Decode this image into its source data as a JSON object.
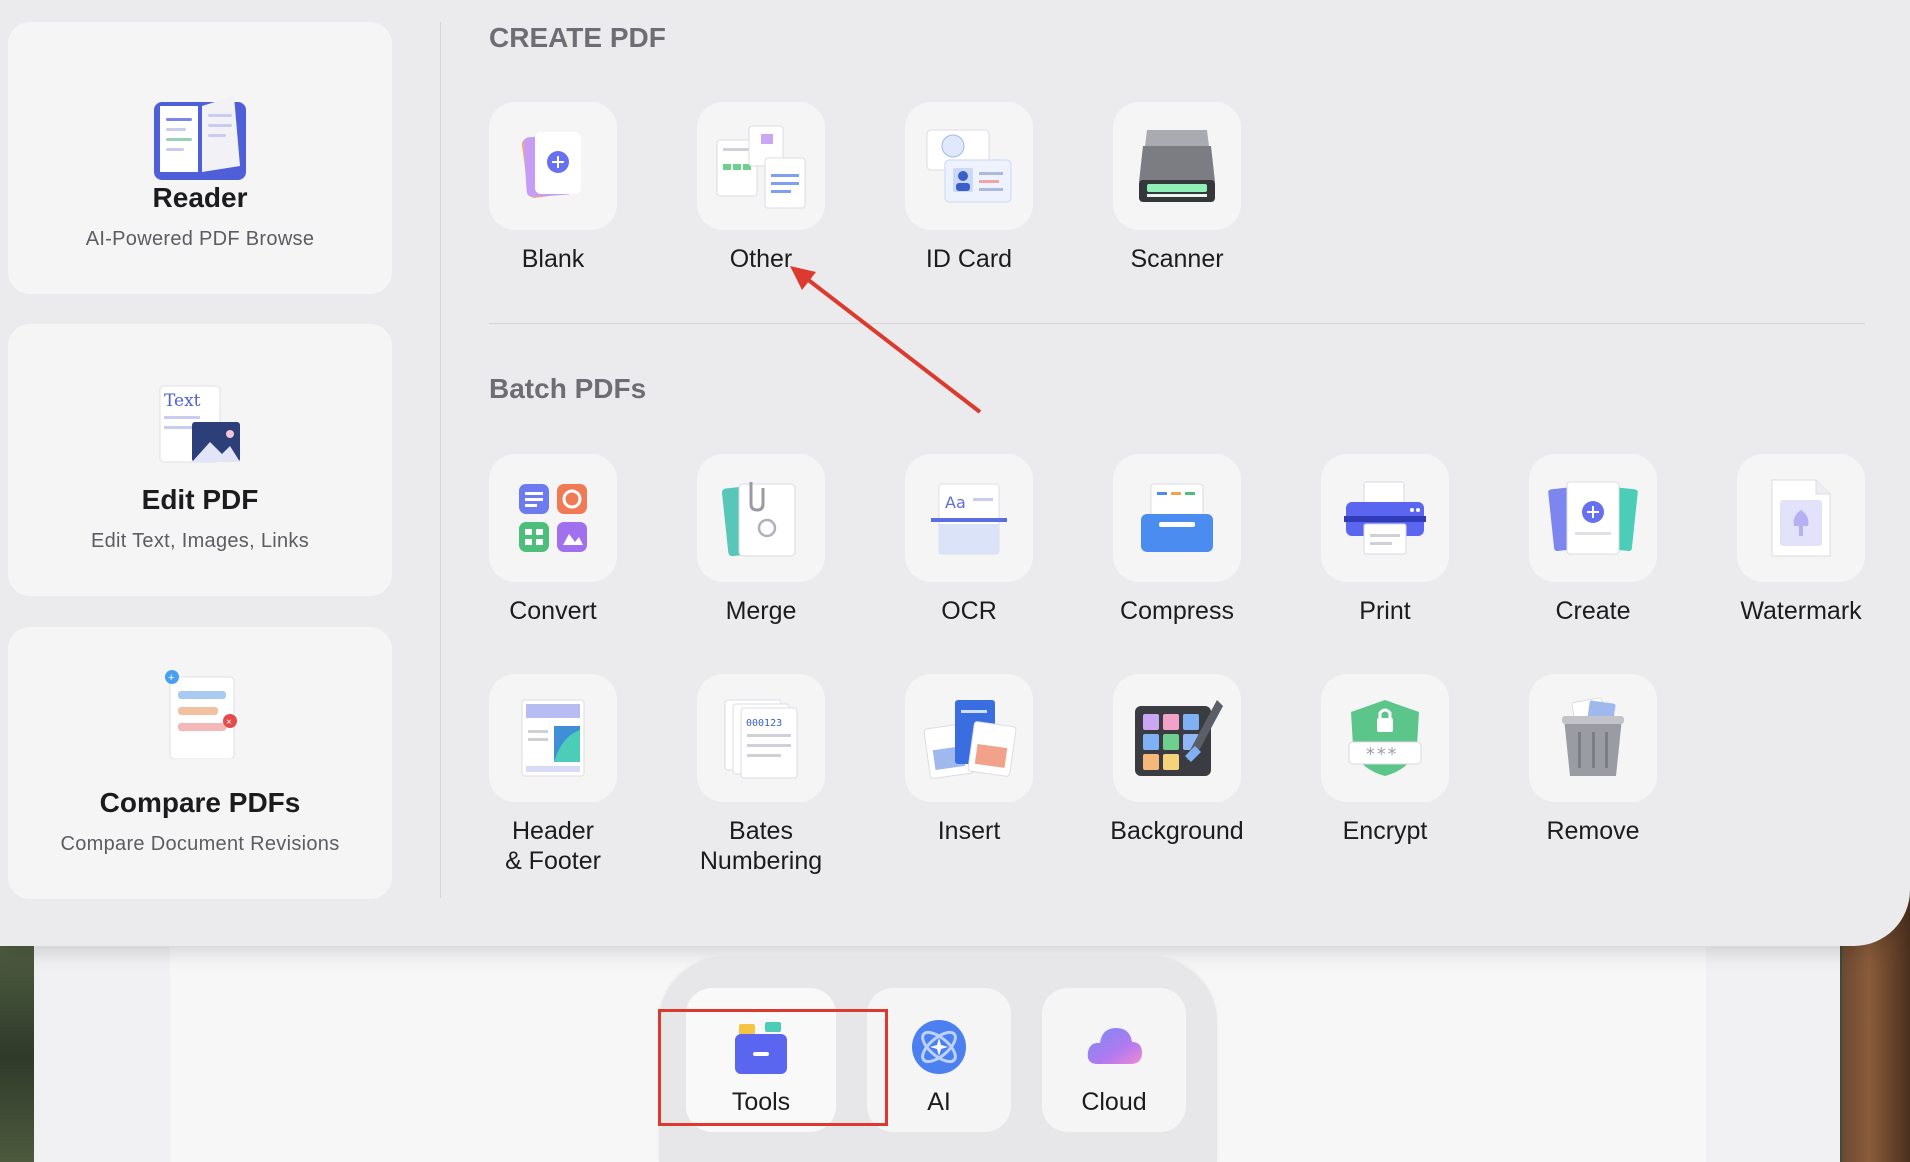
{
  "sidebar": {
    "cards": [
      {
        "title": "Reader",
        "subtitle": "AI-Powered PDF Browse",
        "icon": "open-book-icon"
      },
      {
        "title": "Edit PDF",
        "subtitle": "Edit Text, Images, Links",
        "icon": "edit-text-image-icon",
        "icon_text": "Text"
      },
      {
        "title": "Compare PDFs",
        "subtitle": "Compare Document Revisions",
        "icon": "compare-documents-icon"
      }
    ]
  },
  "create_pdf": {
    "heading": "CREATE PDF",
    "items": [
      {
        "label": "Blank",
        "icon": "blank-page-plus-icon"
      },
      {
        "label": "Other",
        "icon": "other-documents-icon"
      },
      {
        "label": "ID Card",
        "icon": "id-card-icon"
      },
      {
        "label": "Scanner",
        "icon": "scanner-icon"
      }
    ]
  },
  "batch_pdfs": {
    "heading": "Batch PDFs",
    "items": [
      {
        "label": "Convert",
        "icon": "convert-grid-icon"
      },
      {
        "label": "Merge",
        "icon": "merge-clip-icon"
      },
      {
        "label": "OCR",
        "icon": "ocr-scan-icon",
        "icon_text": "Aa"
      },
      {
        "label": "Compress",
        "icon": "compress-tray-icon"
      },
      {
        "label": "Print",
        "icon": "printer-icon"
      },
      {
        "label": "Create",
        "icon": "create-plus-icon"
      },
      {
        "label": "Watermark",
        "icon": "watermark-icon"
      },
      {
        "label_line1": "Header",
        "label_line2": "& Footer",
        "icon": "header-footer-icon"
      },
      {
        "label_line1": "Bates",
        "label_line2": "Numbering",
        "icon": "bates-numbering-icon",
        "icon_text": "000123"
      },
      {
        "label": "Insert",
        "icon": "insert-pages-icon"
      },
      {
        "label": "Background",
        "icon": "background-palette-icon"
      },
      {
        "label": "Encrypt",
        "icon": "encrypt-shield-icon",
        "icon_text": "***"
      },
      {
        "label": "Remove",
        "icon": "trash-can-icon"
      }
    ]
  },
  "dock": {
    "items": [
      {
        "label": "Tools",
        "icon": "tools-box-icon",
        "active": true
      },
      {
        "label": "AI",
        "icon": "ai-orbit-icon"
      },
      {
        "label": "Cloud",
        "icon": "cloud-icon"
      }
    ]
  },
  "colors": {
    "accent": "#5b66f0",
    "annotation_red": "#dc3a2e",
    "panel_bg": "#ebebed",
    "tile_bg": "#f5f5f6"
  }
}
